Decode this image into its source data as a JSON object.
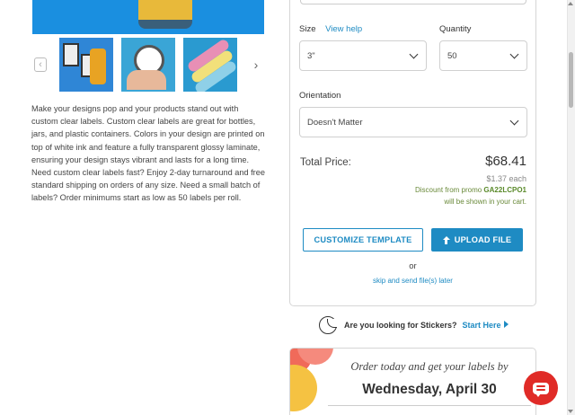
{
  "gallery": {
    "hero_image": "clear-label-jar-image",
    "thumbnails": [
      "clear-labels-bottles",
      "clear-label-in-hand",
      "clear-label-rolls"
    ],
    "prev_icon": "chevron-left-icon",
    "next_icon": "chevron-right-icon"
  },
  "description": "Make your designs pop and your products stand out with custom clear labels. Custom clear labels are great for bottles, jars, and plastic containers. Colors in your design are printed on top of white ink and feature a fully transparent glossy laminate, ensuring your design stays vibrant and lasts for a long time. Need custom clear labels fast? Enjoy 2-day turnaround and free standard shipping on orders of any size. Need a small batch of labels? Order minimums start as low as 50 labels per roll.",
  "options": {
    "size_label": "Size",
    "size_help": "View help",
    "size_value": "3\"",
    "quantity_label": "Quantity",
    "quantity_value": "50",
    "orientation_label": "Orientation",
    "orientation_value": "Doesn't Matter"
  },
  "pricing": {
    "total_label": "Total Price:",
    "total_price": "$68.41",
    "each_price": "$1.37 each",
    "promo_prefix": "Discount from promo ",
    "promo_code": "GA22LCPO1",
    "promo_suffix": "will be shown in your cart."
  },
  "actions": {
    "customize_label": "CUSTOMIZE TEMPLATE",
    "upload_label": "UPLOAD FILE",
    "or_label": "or",
    "skip_label": "skip and send file(s) later"
  },
  "stickers": {
    "question": "Are you looking for Stickers?",
    "link": "Start Here"
  },
  "order": {
    "prompt": "Order today and get your labels by",
    "date": "Wednesday, April 30"
  },
  "colors": {
    "accent": "#1e8bc3",
    "promo": "#6a8a3a",
    "chat": "#e02b27"
  }
}
